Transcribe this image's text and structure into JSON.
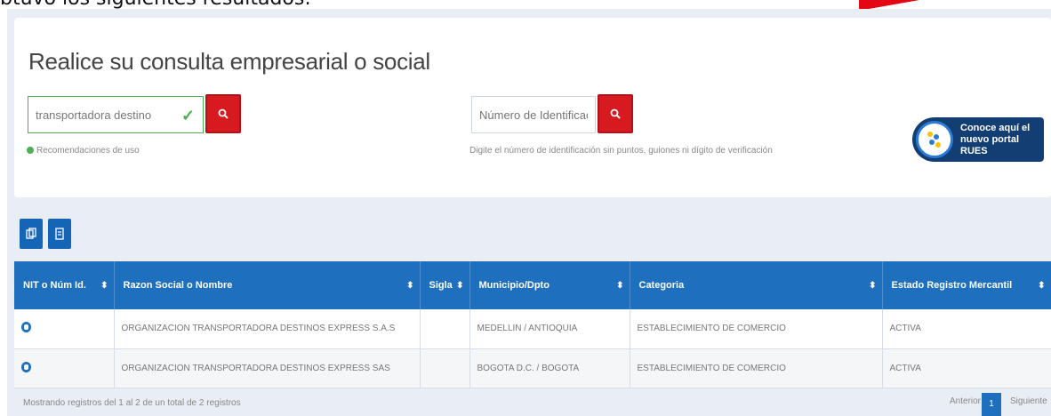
{
  "page": {
    "top_caption": "btuvo los siguientes resultados:",
    "title": "Realice su consulta empresarial o social"
  },
  "search_name": {
    "value": "transportadora destino",
    "hint": "Recomendaciones de uso"
  },
  "search_id": {
    "placeholder": "Número de Identificació",
    "hint": "Digite el número de identificación sin puntos, guiones ni dígito de verificación"
  },
  "rues_button": {
    "label": "Conoce aquí el nuevo portal RUES"
  },
  "toolbar": {
    "icons": [
      "copy-icon",
      "export-icon"
    ]
  },
  "table": {
    "columns": [
      "NIT o Núm Id.",
      "Razon Social o Nombre",
      "Sigla",
      "Municipio/Dpto",
      "Categoria",
      "Estado Registro Mercantil"
    ],
    "rows": [
      {
        "nit": "",
        "razon_social": "ORGANIZACION TRANSPORTADORA DESTINOS EXPRESS S.A.S",
        "sigla": "",
        "municipio": "MEDELLIN / ANTIOQUIA",
        "categoria": "ESTABLECIMIENTO DE COMERCIO",
        "estado": "ACTIVA"
      },
      {
        "nit": "",
        "razon_social": "ORGANIZACION TRANSPORTADORA DESTINOS EXPRESS SAS",
        "sigla": "",
        "municipio": "BOGOTA D.C. / BOGOTA",
        "categoria": "ESTABLECIMIENTO DE COMERCIO",
        "estado": "ACTIVA"
      }
    ]
  },
  "footer": {
    "info": "Mostrando registros del 1 al 2 de un total de 2 registros",
    "prev_label": "Anterior",
    "page": "1",
    "next_label": "Siguiente"
  },
  "colors": {
    "brand_blue": "#1e6fbe",
    "search_red": "#d71920",
    "rues_navy": "#123e73",
    "valid_green": "#4caf50"
  }
}
